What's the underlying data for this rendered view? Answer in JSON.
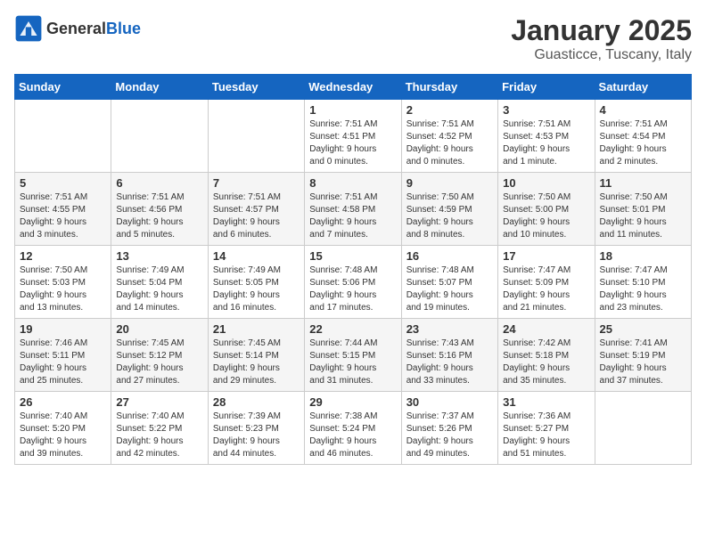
{
  "header": {
    "logo_general": "General",
    "logo_blue": "Blue",
    "title": "January 2025",
    "subtitle": "Guasticce, Tuscany, Italy"
  },
  "days_of_week": [
    "Sunday",
    "Monday",
    "Tuesday",
    "Wednesday",
    "Thursday",
    "Friday",
    "Saturday"
  ],
  "weeks": [
    [
      {
        "day": "",
        "text": ""
      },
      {
        "day": "",
        "text": ""
      },
      {
        "day": "",
        "text": ""
      },
      {
        "day": "1",
        "text": "Sunrise: 7:51 AM\nSunset: 4:51 PM\nDaylight: 9 hours\nand 0 minutes."
      },
      {
        "day": "2",
        "text": "Sunrise: 7:51 AM\nSunset: 4:52 PM\nDaylight: 9 hours\nand 0 minutes."
      },
      {
        "day": "3",
        "text": "Sunrise: 7:51 AM\nSunset: 4:53 PM\nDaylight: 9 hours\nand 1 minute."
      },
      {
        "day": "4",
        "text": "Sunrise: 7:51 AM\nSunset: 4:54 PM\nDaylight: 9 hours\nand 2 minutes."
      }
    ],
    [
      {
        "day": "5",
        "text": "Sunrise: 7:51 AM\nSunset: 4:55 PM\nDaylight: 9 hours\nand 3 minutes."
      },
      {
        "day": "6",
        "text": "Sunrise: 7:51 AM\nSunset: 4:56 PM\nDaylight: 9 hours\nand 5 minutes."
      },
      {
        "day": "7",
        "text": "Sunrise: 7:51 AM\nSunset: 4:57 PM\nDaylight: 9 hours\nand 6 minutes."
      },
      {
        "day": "8",
        "text": "Sunrise: 7:51 AM\nSunset: 4:58 PM\nDaylight: 9 hours\nand 7 minutes."
      },
      {
        "day": "9",
        "text": "Sunrise: 7:50 AM\nSunset: 4:59 PM\nDaylight: 9 hours\nand 8 minutes."
      },
      {
        "day": "10",
        "text": "Sunrise: 7:50 AM\nSunset: 5:00 PM\nDaylight: 9 hours\nand 10 minutes."
      },
      {
        "day": "11",
        "text": "Sunrise: 7:50 AM\nSunset: 5:01 PM\nDaylight: 9 hours\nand 11 minutes."
      }
    ],
    [
      {
        "day": "12",
        "text": "Sunrise: 7:50 AM\nSunset: 5:03 PM\nDaylight: 9 hours\nand 13 minutes."
      },
      {
        "day": "13",
        "text": "Sunrise: 7:49 AM\nSunset: 5:04 PM\nDaylight: 9 hours\nand 14 minutes."
      },
      {
        "day": "14",
        "text": "Sunrise: 7:49 AM\nSunset: 5:05 PM\nDaylight: 9 hours\nand 16 minutes."
      },
      {
        "day": "15",
        "text": "Sunrise: 7:48 AM\nSunset: 5:06 PM\nDaylight: 9 hours\nand 17 minutes."
      },
      {
        "day": "16",
        "text": "Sunrise: 7:48 AM\nSunset: 5:07 PM\nDaylight: 9 hours\nand 19 minutes."
      },
      {
        "day": "17",
        "text": "Sunrise: 7:47 AM\nSunset: 5:09 PM\nDaylight: 9 hours\nand 21 minutes."
      },
      {
        "day": "18",
        "text": "Sunrise: 7:47 AM\nSunset: 5:10 PM\nDaylight: 9 hours\nand 23 minutes."
      }
    ],
    [
      {
        "day": "19",
        "text": "Sunrise: 7:46 AM\nSunset: 5:11 PM\nDaylight: 9 hours\nand 25 minutes."
      },
      {
        "day": "20",
        "text": "Sunrise: 7:45 AM\nSunset: 5:12 PM\nDaylight: 9 hours\nand 27 minutes."
      },
      {
        "day": "21",
        "text": "Sunrise: 7:45 AM\nSunset: 5:14 PM\nDaylight: 9 hours\nand 29 minutes."
      },
      {
        "day": "22",
        "text": "Sunrise: 7:44 AM\nSunset: 5:15 PM\nDaylight: 9 hours\nand 31 minutes."
      },
      {
        "day": "23",
        "text": "Sunrise: 7:43 AM\nSunset: 5:16 PM\nDaylight: 9 hours\nand 33 minutes."
      },
      {
        "day": "24",
        "text": "Sunrise: 7:42 AM\nSunset: 5:18 PM\nDaylight: 9 hours\nand 35 minutes."
      },
      {
        "day": "25",
        "text": "Sunrise: 7:41 AM\nSunset: 5:19 PM\nDaylight: 9 hours\nand 37 minutes."
      }
    ],
    [
      {
        "day": "26",
        "text": "Sunrise: 7:40 AM\nSunset: 5:20 PM\nDaylight: 9 hours\nand 39 minutes."
      },
      {
        "day": "27",
        "text": "Sunrise: 7:40 AM\nSunset: 5:22 PM\nDaylight: 9 hours\nand 42 minutes."
      },
      {
        "day": "28",
        "text": "Sunrise: 7:39 AM\nSunset: 5:23 PM\nDaylight: 9 hours\nand 44 minutes."
      },
      {
        "day": "29",
        "text": "Sunrise: 7:38 AM\nSunset: 5:24 PM\nDaylight: 9 hours\nand 46 minutes."
      },
      {
        "day": "30",
        "text": "Sunrise: 7:37 AM\nSunset: 5:26 PM\nDaylight: 9 hours\nand 49 minutes."
      },
      {
        "day": "31",
        "text": "Sunrise: 7:36 AM\nSunset: 5:27 PM\nDaylight: 9 hours\nand 51 minutes."
      },
      {
        "day": "",
        "text": ""
      }
    ]
  ]
}
